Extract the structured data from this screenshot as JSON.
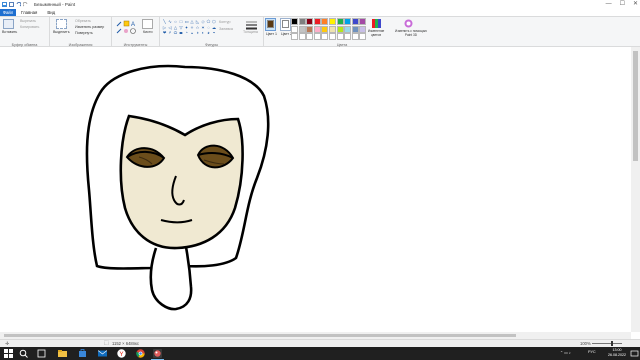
{
  "window": {
    "title": "Безымянный - Paint",
    "controls": [
      "—",
      "☐",
      "✕"
    ]
  },
  "tabs": [
    {
      "label": "Файл"
    },
    {
      "label": "Главная"
    },
    {
      "label": "Вид"
    }
  ],
  "ribbon": {
    "clipboard": {
      "paste": "Вставить",
      "cut": "Вырезать",
      "copy": "Копировать",
      "group_label": "Буфер обмена"
    },
    "image": {
      "select": "Выделить",
      "crop": "Обрезать",
      "resize": "Изменить размер",
      "rotate": "Повернуть",
      "group_label": "Изображения"
    },
    "tools": {
      "brushes": "Кисти",
      "group_label": "Инструменты"
    },
    "shapes": {
      "outline": "Контур",
      "fill": "Заливка",
      "group_label": "Фигуры"
    },
    "size": {
      "label": "Толщина"
    },
    "colors": {
      "color1": "Цвет 1",
      "color2": "Цвет 2",
      "edit_colors": "Изменение цветов",
      "paint3d": "Изменить с помощью Paint 3D",
      "group_label": "Цвета",
      "color1_value": "#5b3a14",
      "color2_value": "#ffffff",
      "palette": [
        "#000000",
        "#7f7f7f",
        "#880015",
        "#ed1c24",
        "#ff7f27",
        "#fff200",
        "#22b14c",
        "#00a2e8",
        "#3f48cc",
        "#a349a4",
        "#ffffff",
        "#c3c3c3",
        "#b97a57",
        "#ffaec9",
        "#ffc90e",
        "#efe4b0",
        "#b5e61d",
        "#99d9ea",
        "#7092be",
        "#c8bfe7",
        "#ffffff",
        "#ffffff",
        "#ffffff",
        "#ffffff",
        "#ffffff",
        "#ffffff",
        "#ffffff",
        "#ffffff",
        "#ffffff",
        "#ffffff"
      ]
    }
  },
  "status": {
    "canvas_size": "1152 × 648пкс",
    "zoom": "100%"
  },
  "taskbar": {
    "tray_lang": "РУС",
    "time": "13:00",
    "date": "26.08.2022"
  }
}
